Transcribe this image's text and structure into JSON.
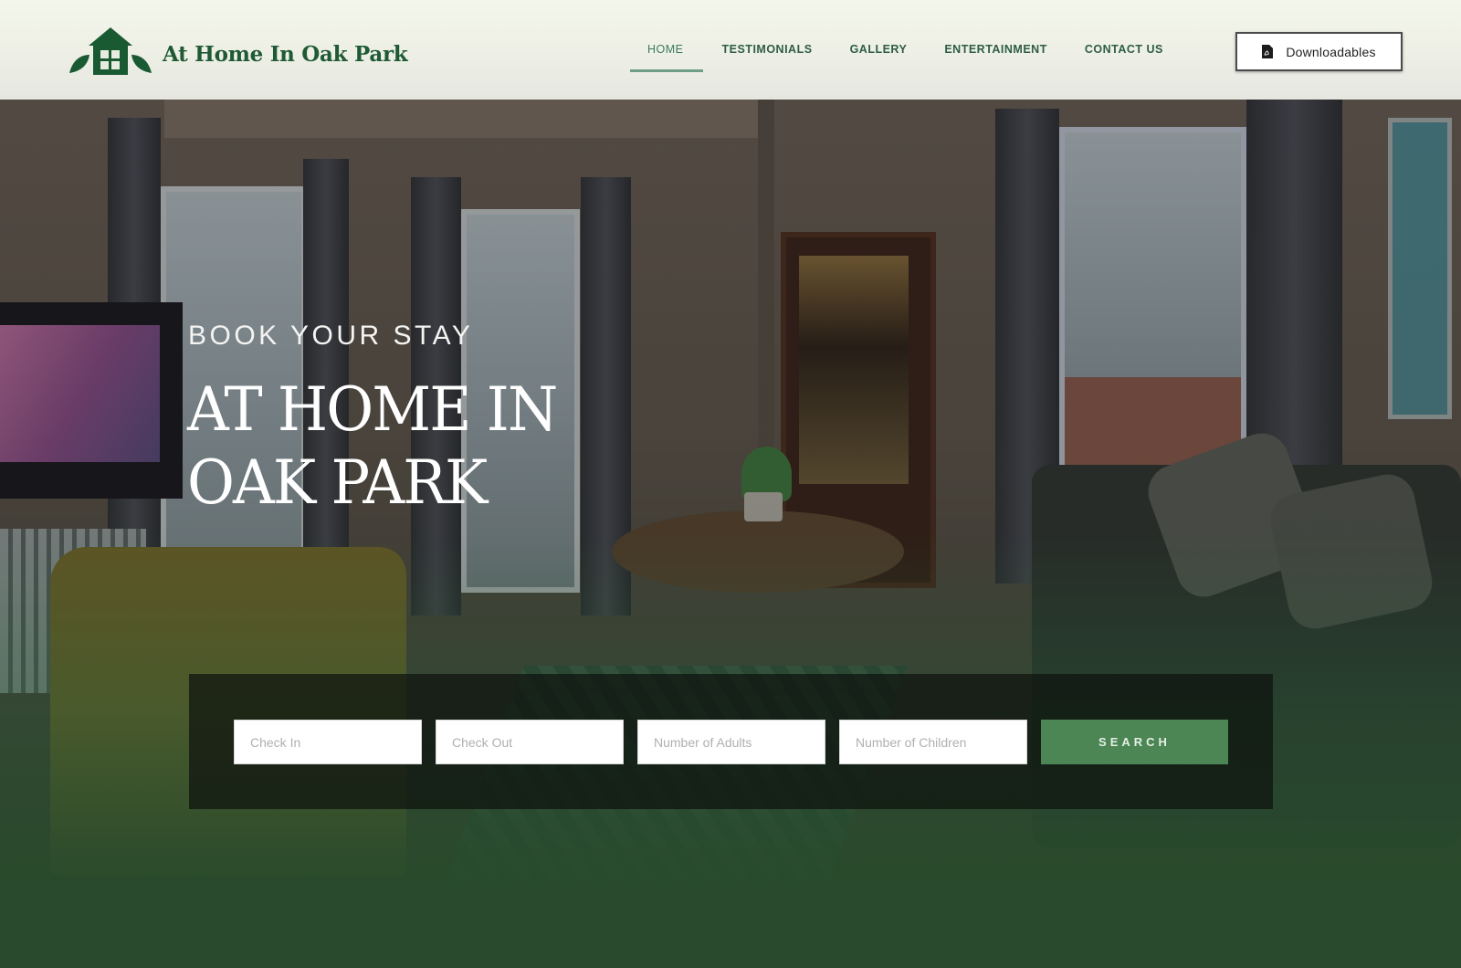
{
  "brand": {
    "name": "At Home In Oak Park",
    "logo_icon": "house-with-leaves-icon",
    "color": "#1f5a34"
  },
  "nav": {
    "items": [
      {
        "label": "HOME",
        "active": true
      },
      {
        "label": "TESTIMONIALS",
        "active": false
      },
      {
        "label": "GALLERY",
        "active": false
      },
      {
        "label": "ENTERTAINMENT",
        "active": false
      },
      {
        "label": "CONTACT US",
        "active": false
      }
    ],
    "downloads_button": {
      "label": "Downloadables",
      "icon": "pdf-file-icon"
    }
  },
  "hero": {
    "eyebrow": "BOOK YOUR STAY",
    "title_line1": "AT HOME IN",
    "title_line2": "OAK PARK",
    "background": "living-room-photo"
  },
  "booking": {
    "check_in_placeholder": "Check In",
    "check_out_placeholder": "Check Out",
    "adults_placeholder": "Number of Adults",
    "children_placeholder": "Number of Children",
    "search_label": "SEARCH",
    "accent": "#4c8654"
  }
}
